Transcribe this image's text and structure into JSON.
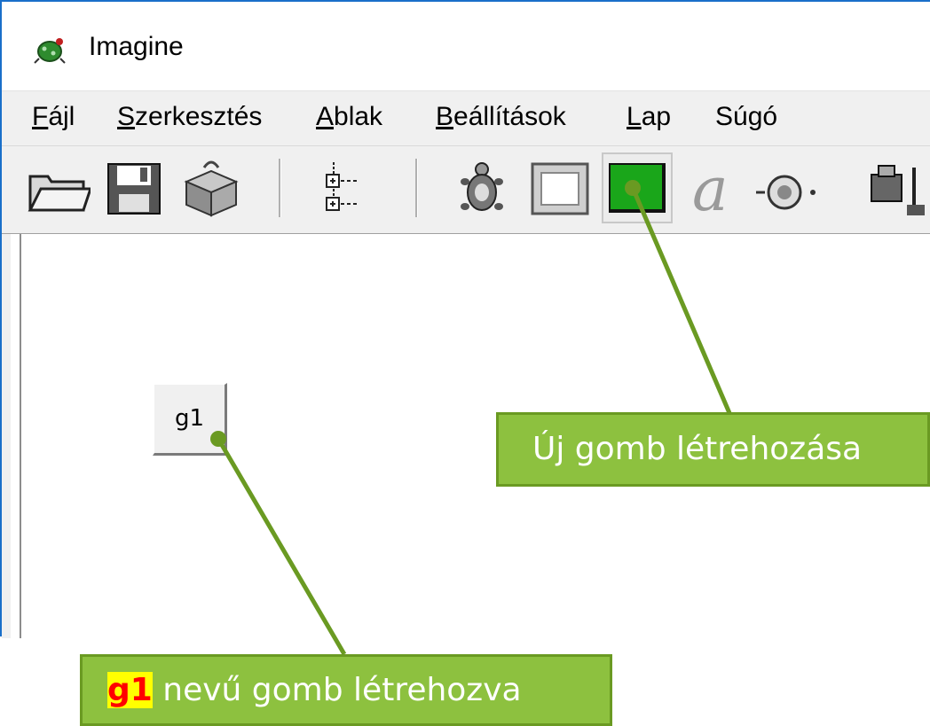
{
  "window": {
    "title": "Imagine"
  },
  "menubar": {
    "items": [
      {
        "accel": "F",
        "rest": "ájl"
      },
      {
        "accel": "S",
        "rest": "zerkesztés"
      },
      {
        "accel": "A",
        "rest": "blak"
      },
      {
        "accel": "B",
        "rest": "eállítások"
      },
      {
        "accel": "L",
        "rest": "ap"
      },
      {
        "accel": "",
        "rest": "Súgó"
      }
    ]
  },
  "toolbar": {
    "buttons": [
      "open-folder-icon",
      "save-disk-icon",
      "package-icon",
      "tree-icon",
      "turtle-icon",
      "panel-icon",
      "new-button-icon",
      "text-a-icon",
      "slider-icon",
      "camera-icon"
    ]
  },
  "canvas": {
    "button_label": "g1"
  },
  "callouts": {
    "new_button": "Új gomb létrehozása",
    "created_highlight": "g1",
    "created_rest": " nevű gomb létrehozva"
  },
  "colors": {
    "callout_bg": "#8dc13f",
    "callout_border": "#6a9a22",
    "line": "#6a9a22",
    "highlight": "#ffff00",
    "highlight_text": "#ff0000"
  }
}
